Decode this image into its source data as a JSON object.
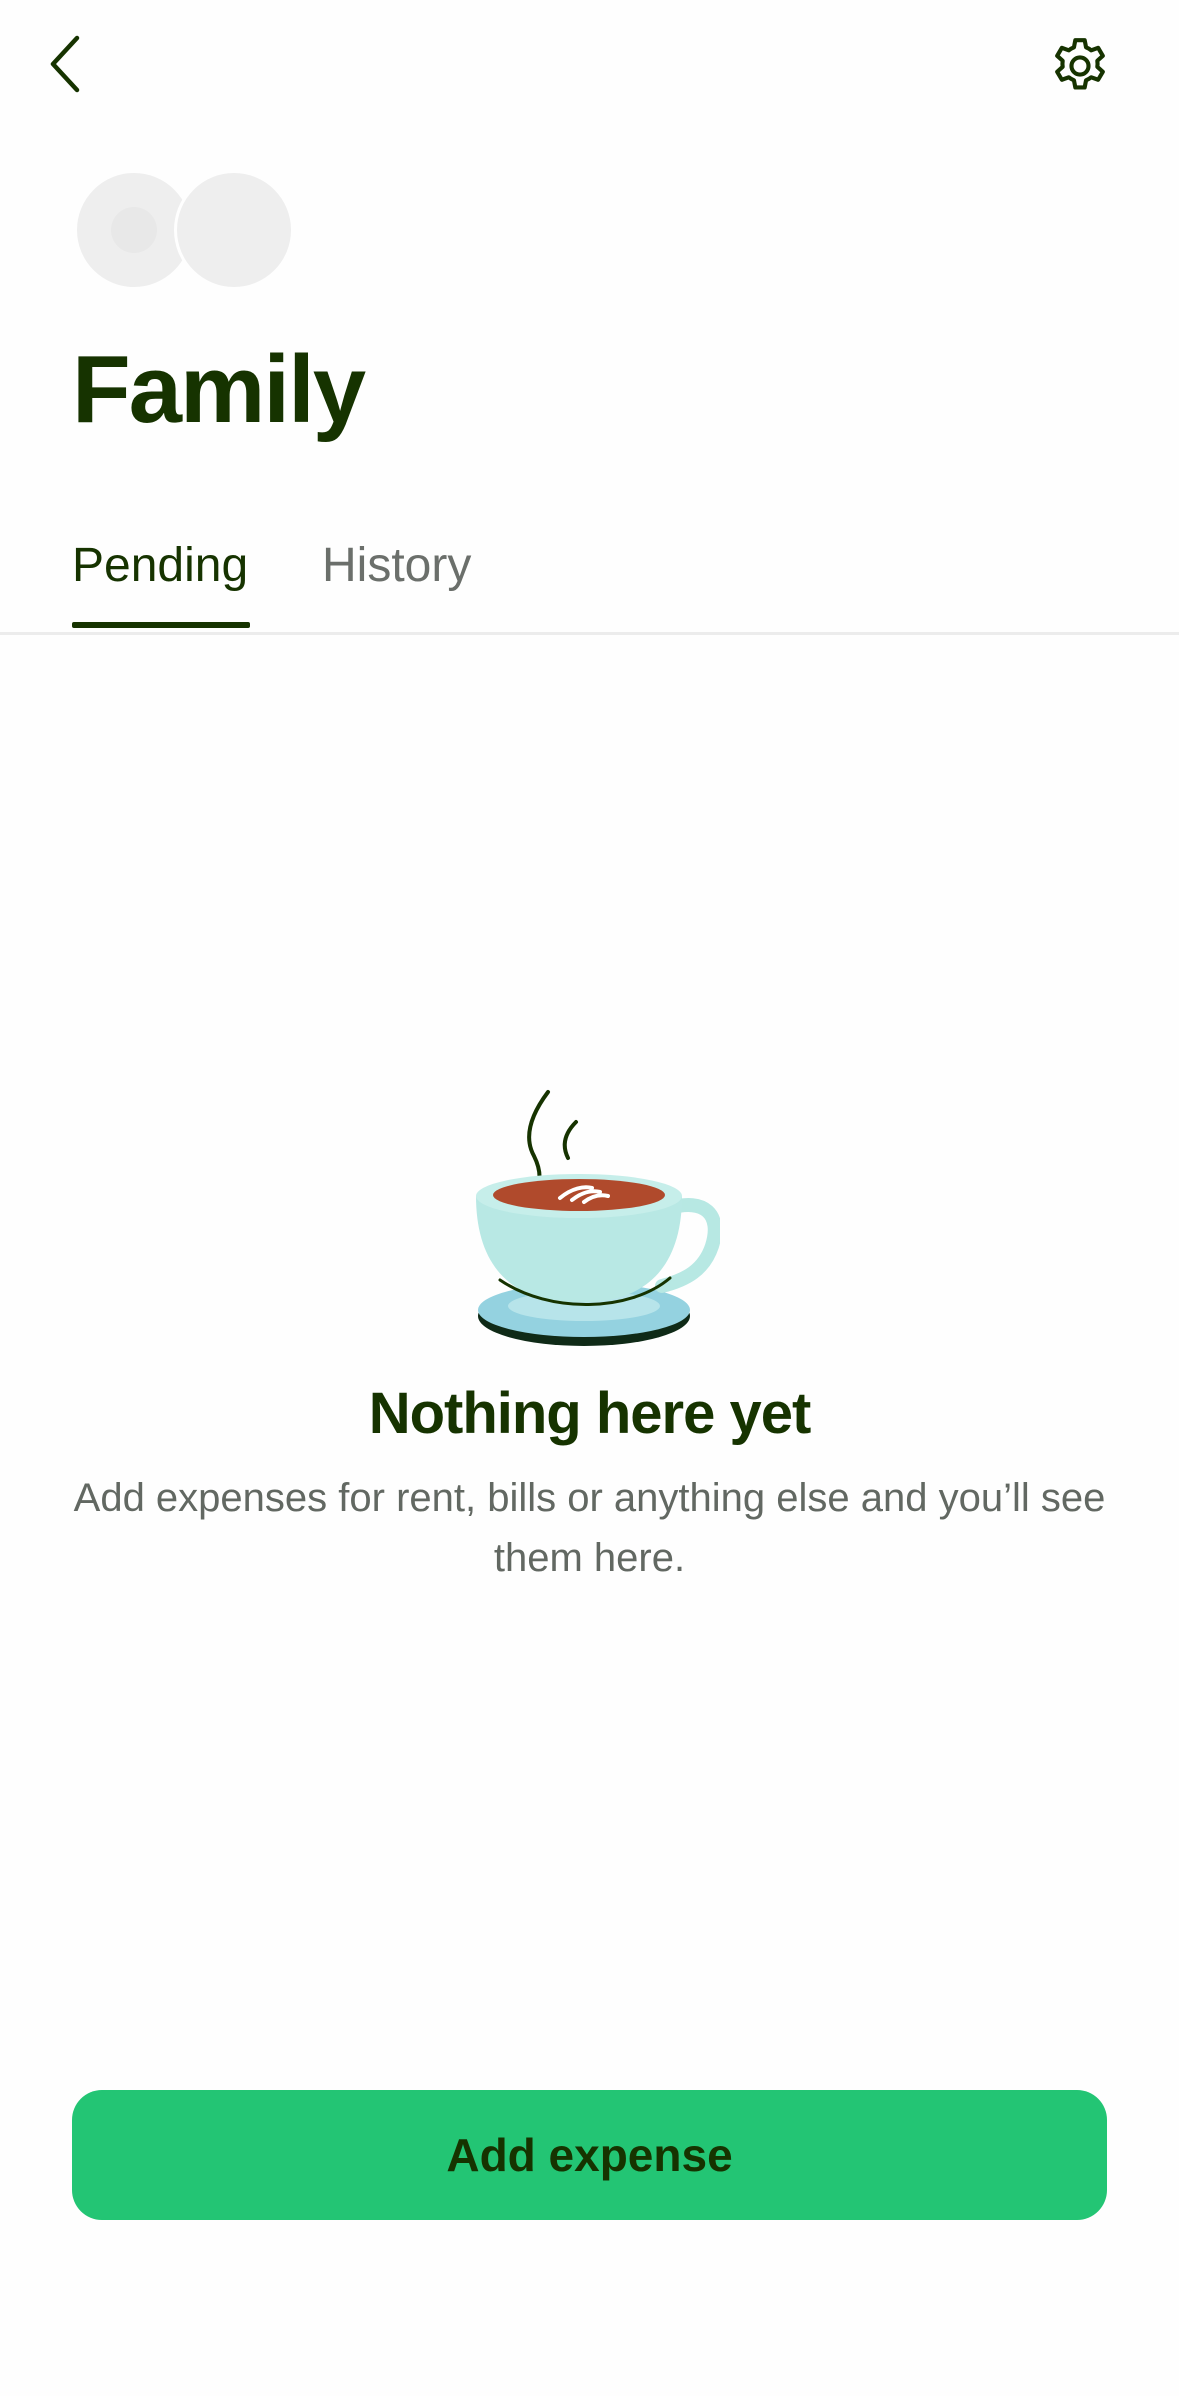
{
  "header": {
    "back_icon": "chevron-left-icon",
    "settings_icon": "gear-icon"
  },
  "group": {
    "title": "Family",
    "avatars": [
      "avatar",
      "avatar"
    ]
  },
  "tabs": [
    {
      "label": "Pending",
      "active": true
    },
    {
      "label": "History",
      "active": false
    }
  ],
  "empty_state": {
    "illustration": "coffee-cup-illustration",
    "title": "Nothing here yet",
    "description": "Add expenses for rent, bills or anything else and you’ll see them here."
  },
  "actions": {
    "add_expense_label": "Add expense"
  },
  "colors": {
    "primary_text": "#163300",
    "accent_green": "#23c574",
    "muted_text": "#626862"
  }
}
